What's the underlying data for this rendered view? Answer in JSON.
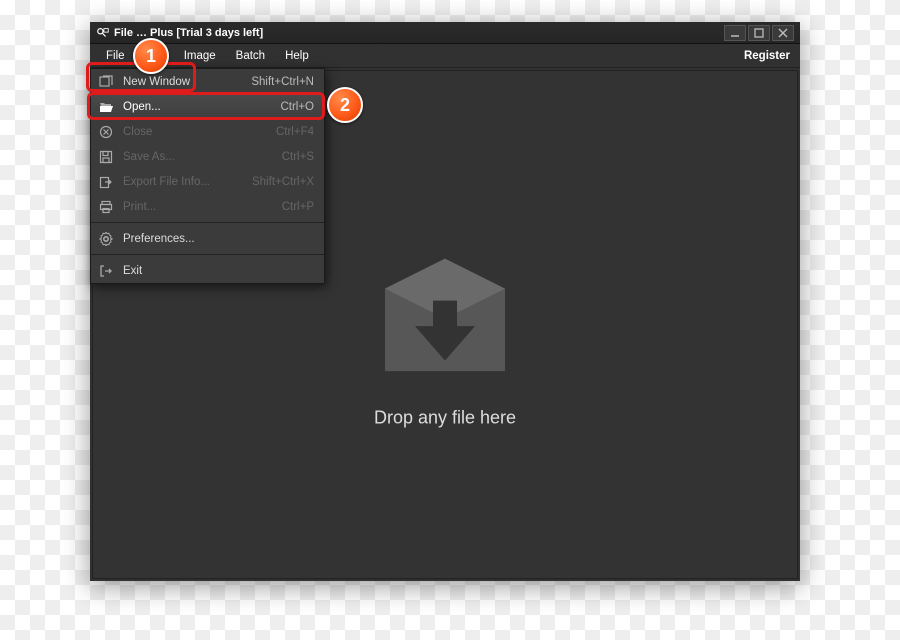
{
  "title": "File … Plus [Trial 3 days left]",
  "menubar": {
    "file": "File",
    "edit": "E…",
    "image": "Image",
    "batch": "Batch",
    "help": "Help",
    "register": "Register"
  },
  "dropdown": {
    "new_window": {
      "label": "New Window",
      "shortcut": "Shift+Ctrl+N"
    },
    "open": {
      "label": "Open...",
      "shortcut": "Ctrl+O"
    },
    "close": {
      "label": "Close",
      "shortcut": "Ctrl+F4"
    },
    "save_as": {
      "label": "Save As...",
      "shortcut": "Ctrl+S"
    },
    "export": {
      "label": "Export File Info...",
      "shortcut": "Shift+Ctrl+X"
    },
    "print": {
      "label": "Print...",
      "shortcut": "Ctrl+P"
    },
    "prefs": {
      "label": "Preferences..."
    },
    "exit": {
      "label": "Exit"
    }
  },
  "drop_hint": "Drop any file here",
  "callouts": {
    "step1": "1",
    "step2": "2"
  }
}
